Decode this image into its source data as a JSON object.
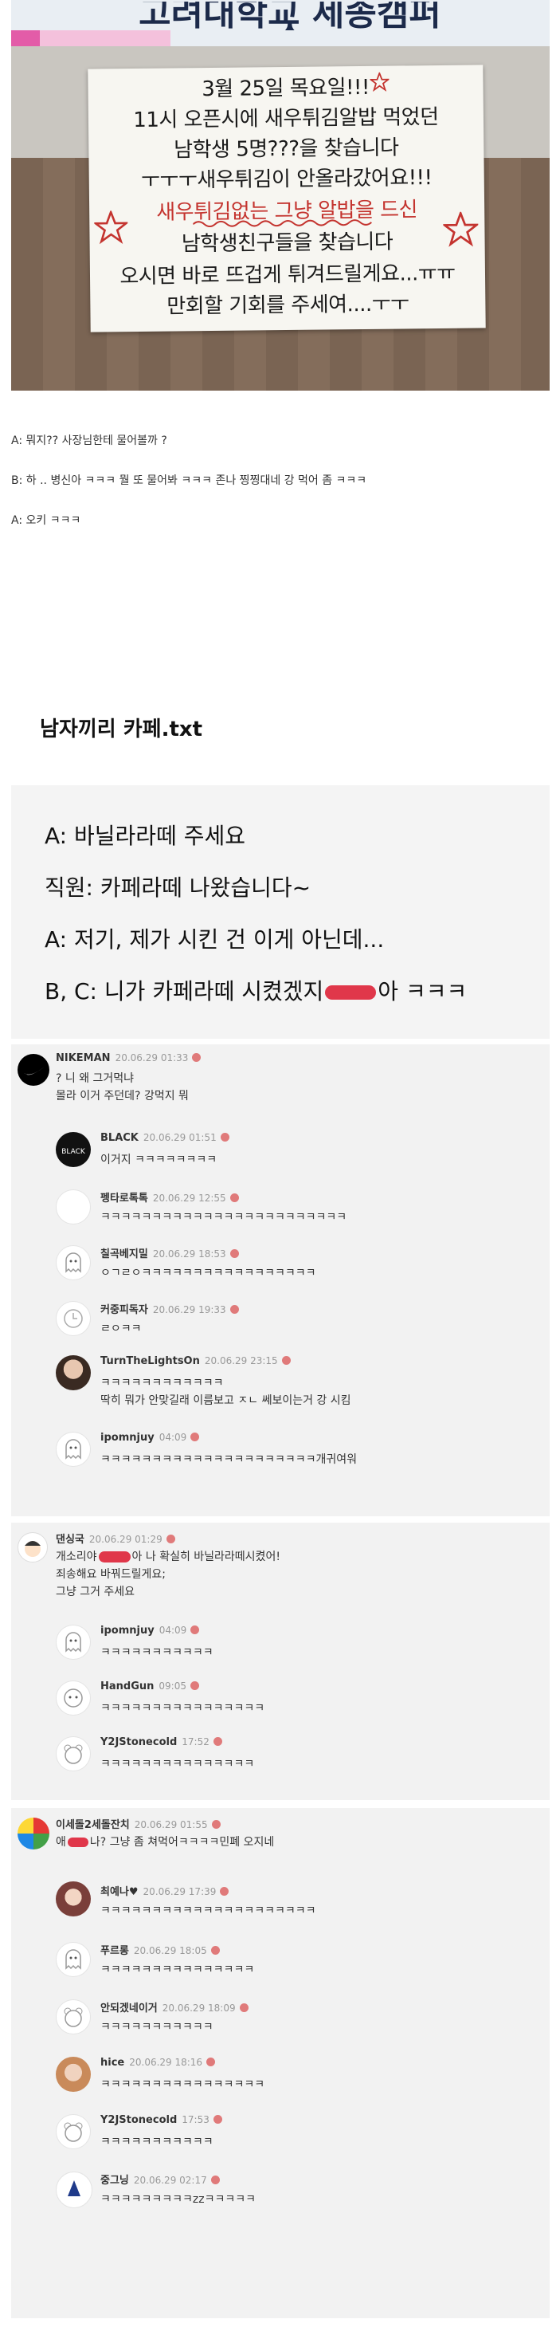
{
  "photo": {
    "banner_text": "고려대학교 세종캠퍼스",
    "notice_lines": [
      "3월 25일 목요일!!!",
      "11시 오픈시에 새우튀김알밥 먹었던",
      "남학생 5명???을 찾습니다",
      "ㅜㅜㅜ새우튀김이 안올라갔어요!!!",
      "새우튀김없는 그냥 알밥을 드신",
      "남학생친구들을 찾습니다",
      "오시면 바로 뜨겁게 튀겨드릴게요...ㅠㅠ",
      "만회할 기회를 주세여....ㅜㅜ"
    ]
  },
  "dialogue": [
    "A: 뭐지?? 사장님한테 물어볼까 ?",
    "B: 하 .. 병신아 ㅋㅋㅋ 뭘 또 물어봐 ㅋㅋㅋ 존나 찡찡대네      강 먹어 좀 ㅋㅋㅋ",
    "A: 오키 ㅋㅋㅋ"
  ],
  "section_title": "남자끼리 카페.txt",
  "cafe": {
    "line1": "A: 바닐라라떼 주세요",
    "line2": "직원: 카페라떼 나왔습니다~",
    "line3": "A: 저기, 제가 시킨 건 이게 아닌데...",
    "line4_pre": "B, C: 니가 카페라떼 시켰겠지",
    "line4_post": "아 ㅋㅋㅋ"
  },
  "blocks": [
    {
      "parent": {
        "nick": "NIKEMAN",
        "date": "20.06.29 01:33",
        "lines": [
          "? 니 왜 그거먹냐",
          "몰라 이거 주던데? 강먹지 뭐"
        ]
      },
      "replies": [
        {
          "nick": "BLACK",
          "date": "20.06.29 01:51",
          "text": "이거지 ㅋㅋㅋㅋㅋㅋㅋㅋ"
        },
        {
          "nick": "펭타로톡톡",
          "date": "20.06.29 12:55",
          "text": "ㅋㅋㅋㅋㅋㅋㅋㅋㅋㅋㅋㅋㅋㅋㅋㅋㅋㅋㅋㅋㅋㅋㅋㅋ"
        },
        {
          "nick": "칠곡베지밀",
          "date": "20.06.29 18:53",
          "text": "ㅇㄱㄹㅇㅋㅋㅋㅋㅋㅋㅋㅋㅋㅋㅋㅋㅋㅋㅋㅋㅋ"
        },
        {
          "nick": "커중피독자",
          "date": "20.06.29 19:33",
          "text": "ㄹㅇㅋㅋ"
        },
        {
          "nick": "TurnTheLightsOn",
          "date": "20.06.29 23:15",
          "text": "ㅋㅋㅋㅋㅋㅋㅋㅋㅋㅋㅋㅋ",
          "text2": "딱히 뭐가 안맞길래 이름보고 ㅈㄴ 쎄보이는거 강 시킴"
        },
        {
          "nick": "ipomnjuy",
          "date": "04:09",
          "text": "ㅋㅋㅋㅋㅋㅋㅋㅋㅋㅋㅋㅋㅋㅋㅋㅋㅋㅋㅋㅋㅋ개귀여워"
        }
      ]
    },
    {
      "parent": {
        "nick": "댄싱국",
        "date": "20.06.29 01:29",
        "lines": [
          "개소리야",
          "아 나 확실히 바닐라라떼시켰어!",
          "죄송해요 바꿔드릴게요;",
          "그냥 그거 주세요"
        ]
      },
      "replies": [
        {
          "nick": "ipomnjuy",
          "date": "04:09",
          "text": "ㅋㅋㅋㅋㅋㅋㅋㅋㅋㅋㅋ"
        },
        {
          "nick": "HandGun",
          "date": "09:05",
          "text": "ㅋㅋㅋㅋㅋㅋㅋㅋㅋㅋㅋㅋㅋㅋㅋㅋ"
        },
        {
          "nick": "Y2JStonecold",
          "date": "17:52",
          "text": "ㅋㅋㅋㅋㅋㅋㅋㅋㅋㅋㅋㅋㅋㅋㅋ"
        }
      ]
    },
    {
      "parent": {
        "nick": "이세돌2세돌잔치",
        "date": "20.06.29 01:55",
        "lines": [
          "애",
          "나? 그냥 좀 쳐먹어ㅋㅋㅋㅋ민폐 오지네"
        ]
      },
      "replies": [
        {
          "nick": "최예나♥",
          "date": "20.06.29 17:39",
          "text": "ㅋㅋㅋㅋㅋㅋㅋㅋㅋㅋㅋㅋㅋㅋㅋㅋㅋㅋㅋㅋㅋ"
        },
        {
          "nick": "푸르롱",
          "date": "20.06.29 18:05",
          "text": "ㅋㅋㅋㅋㅋㅋㅋㅋㅋㅋㅋㅋㅋㅋㅋ"
        },
        {
          "nick": "안되겠네이거",
          "date": "20.06.29 18:09",
          "text": "ㅋㅋㅋㅋㅋㅋㅋㅋㅋㅋㅋ"
        },
        {
          "nick": "hice",
          "date": "20.06.29 18:16",
          "text": "ㅋㅋㅋㅋㅋㅋㅋㅋㅋㅋㅋㅋㅋㅋㅋㅋ"
        },
        {
          "nick": "Y2JStonecold",
          "date": "17:53",
          "text": "ㅋㅋㅋㅋㅋㅋㅋㅋㅋㅋㅋ"
        },
        {
          "nick": "중그닝",
          "date": "20.06.29 02:17",
          "text": "ㅋㅋㅋㅋㅋㅋㅋㅋㅋzzㅋㅋㅋㅋㅋ"
        }
      ]
    }
  ],
  "colors": {
    "badge": "#e07a7a",
    "censor": "#e0374a",
    "star": "#c4342f"
  }
}
